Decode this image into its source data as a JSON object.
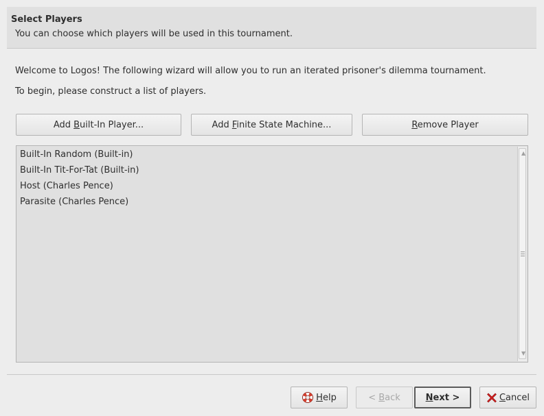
{
  "header": {
    "title": "Select Players",
    "subtitle": "You can choose which players will be used in this tournament."
  },
  "intro": {
    "welcome": "Welcome to Logos!  The following wizard will allow you to run an iterated prisoner's dilemma tournament.",
    "instruction": "To begin, please construct a list of players."
  },
  "toolbar": {
    "add_builtin": {
      "pre": "Add ",
      "mnemonic": "B",
      "post": "uilt-In Player..."
    },
    "add_fsm": {
      "pre": "Add ",
      "mnemonic": "F",
      "post": "inite State Machine..."
    },
    "remove": {
      "pre": "",
      "mnemonic": "R",
      "post": "emove Player"
    }
  },
  "players": [
    "Built-In Random (Built-in)",
    "Built-In Tit-For-Tat (Built-in)",
    "Host (Charles Pence)",
    "Parasite (Charles Pence)"
  ],
  "footer": {
    "help": {
      "pre": "",
      "mnemonic": "H",
      "post": "elp",
      "icon": "help-lifebuoy-icon"
    },
    "back": {
      "pre": "< ",
      "mnemonic": "B",
      "post": "ack",
      "enabled": false
    },
    "next": {
      "pre": "",
      "mnemonic": "N",
      "post": "ext >"
    },
    "cancel": {
      "pre": "",
      "mnemonic": "C",
      "post": "ancel",
      "icon": "cancel-x-icon"
    }
  },
  "colors": {
    "window_bg": "#ededed",
    "header_bg": "#e0e0e0",
    "list_bg": "#e0e0e0",
    "cancel_icon": "#d42020",
    "help_icon_ring": "#d43c2c"
  }
}
